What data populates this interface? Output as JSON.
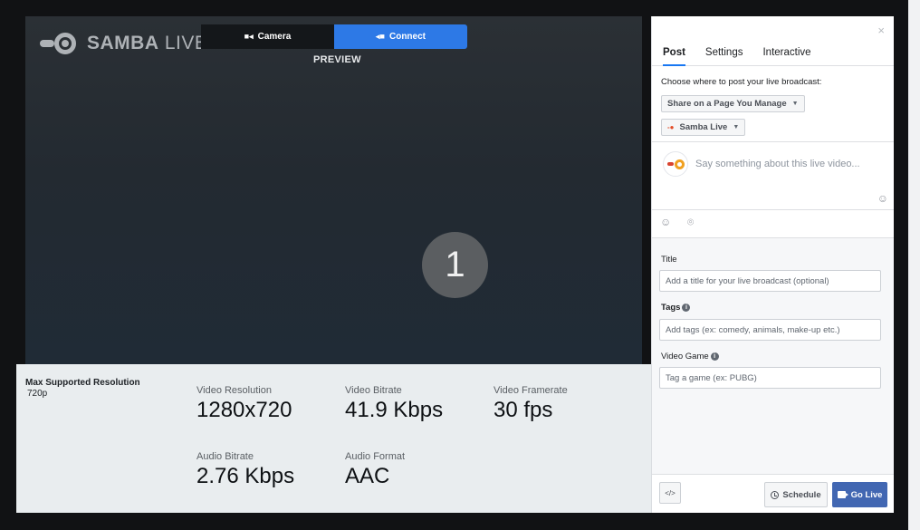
{
  "logo": {
    "word_bold": "SAMBA",
    "word_light": " LIVE"
  },
  "source_tabs": [
    {
      "label": "Camera",
      "icon": "video-camera-icon"
    },
    {
      "label": "Connect",
      "icon": "connect-plug-icon"
    }
  ],
  "preview": {
    "label": "PREVIEW",
    "countdown": "1"
  },
  "stats": {
    "max_resolution_label": "Max Supported Resolution",
    "max_resolution_value": "720p",
    "video_resolution": {
      "label": "Video Resolution",
      "value": "1280x720"
    },
    "video_bitrate": {
      "label": "Video Bitrate",
      "value": "41.9 Kbps"
    },
    "video_framerate": {
      "label": "Video Framerate",
      "value": "30 fps"
    },
    "audio_bitrate": {
      "label": "Audio Bitrate",
      "value": "2.76 Kbps"
    },
    "audio_format": {
      "label": "Audio Format",
      "value": "AAC"
    }
  },
  "panel": {
    "close": "×",
    "tabs": [
      "Post",
      "Settings",
      "Interactive"
    ],
    "choose_label": "Choose where to post your live broadcast:",
    "share_dropdown": "Share on a Page You Manage",
    "page_dropdown": "Samba Live",
    "composer_placeholder": "Say something about this live video...",
    "title_label": "Title",
    "title_placeholder": "Add a title for your live broadcast (optional)",
    "tags_label": "Tags",
    "tags_placeholder": "Add tags (ex: comedy, animals, make-up etc.)",
    "game_label": "Video Game",
    "game_placeholder": "Tag a game (ex: PUBG)",
    "embed_label": "</>",
    "schedule_label": "Schedule",
    "go_live_label": "Go Live"
  },
  "colors": {
    "accent_blue": "#2d79e6",
    "go_live": "#4267b2",
    "stats_bg": "#e9edef"
  }
}
